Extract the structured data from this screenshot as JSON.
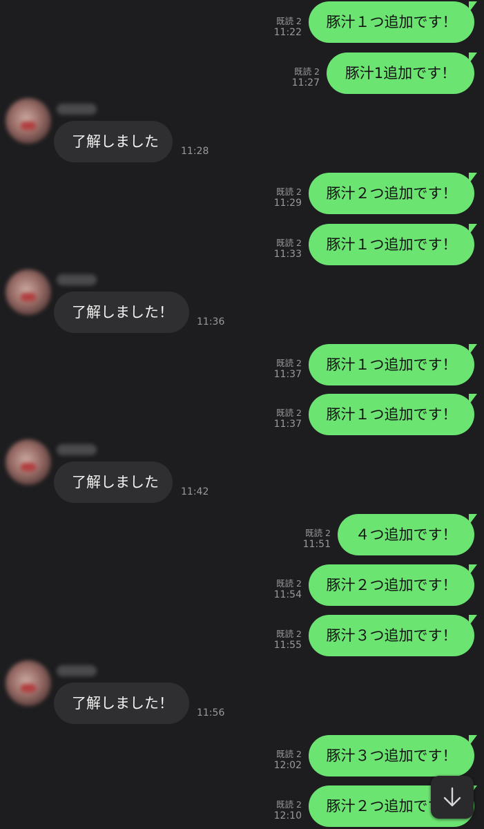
{
  "messages": [
    {
      "kind": "sent",
      "text": "豚汁１つ追加です！",
      "read": "既読 2",
      "time": "11:22"
    },
    {
      "kind": "sent",
      "text": "豚汁1追加です！",
      "read": "既読 2",
      "time": "11:27"
    },
    {
      "kind": "recv",
      "text": "了解しました",
      "time": "11:28"
    },
    {
      "kind": "sent",
      "text": "豚汁２つ追加です！",
      "read": "既読 2",
      "time": "11:29"
    },
    {
      "kind": "sent",
      "text": "豚汁１つ追加です！",
      "read": "既読 2",
      "time": "11:33"
    },
    {
      "kind": "recv",
      "text": "了解しました！",
      "time": "11:36"
    },
    {
      "kind": "sent",
      "text": "豚汁１つ追加です！",
      "read": "既読 2",
      "time": "11:37"
    },
    {
      "kind": "sent",
      "text": "豚汁１つ追加です！",
      "read": "既読 2",
      "time": "11:37"
    },
    {
      "kind": "recv",
      "text": "了解しました",
      "time": "11:42"
    },
    {
      "kind": "sent",
      "text": "４つ追加です！",
      "read": "既読 2",
      "time": "11:51"
    },
    {
      "kind": "sent",
      "text": "豚汁２つ追加です！",
      "read": "既読 2",
      "time": "11:54"
    },
    {
      "kind": "sent",
      "text": "豚汁３つ追加です！",
      "read": "既読 2",
      "time": "11:55"
    },
    {
      "kind": "recv",
      "text": "了解しました！",
      "time": "11:56"
    },
    {
      "kind": "sent",
      "text": "豚汁３つ追加です！",
      "read": "既読 2",
      "time": "12:02"
    },
    {
      "kind": "sent",
      "text": "豚汁２つ追加です！",
      "read": "既読 2",
      "time": "12:10"
    }
  ],
  "scroll_button": {
    "icon": "arrow-down-icon"
  },
  "colors": {
    "background": "#1d1d1f",
    "sent_bubble": "#6ce472",
    "received_bubble": "#2f2f31",
    "meta_text": "#9a9a9d"
  }
}
